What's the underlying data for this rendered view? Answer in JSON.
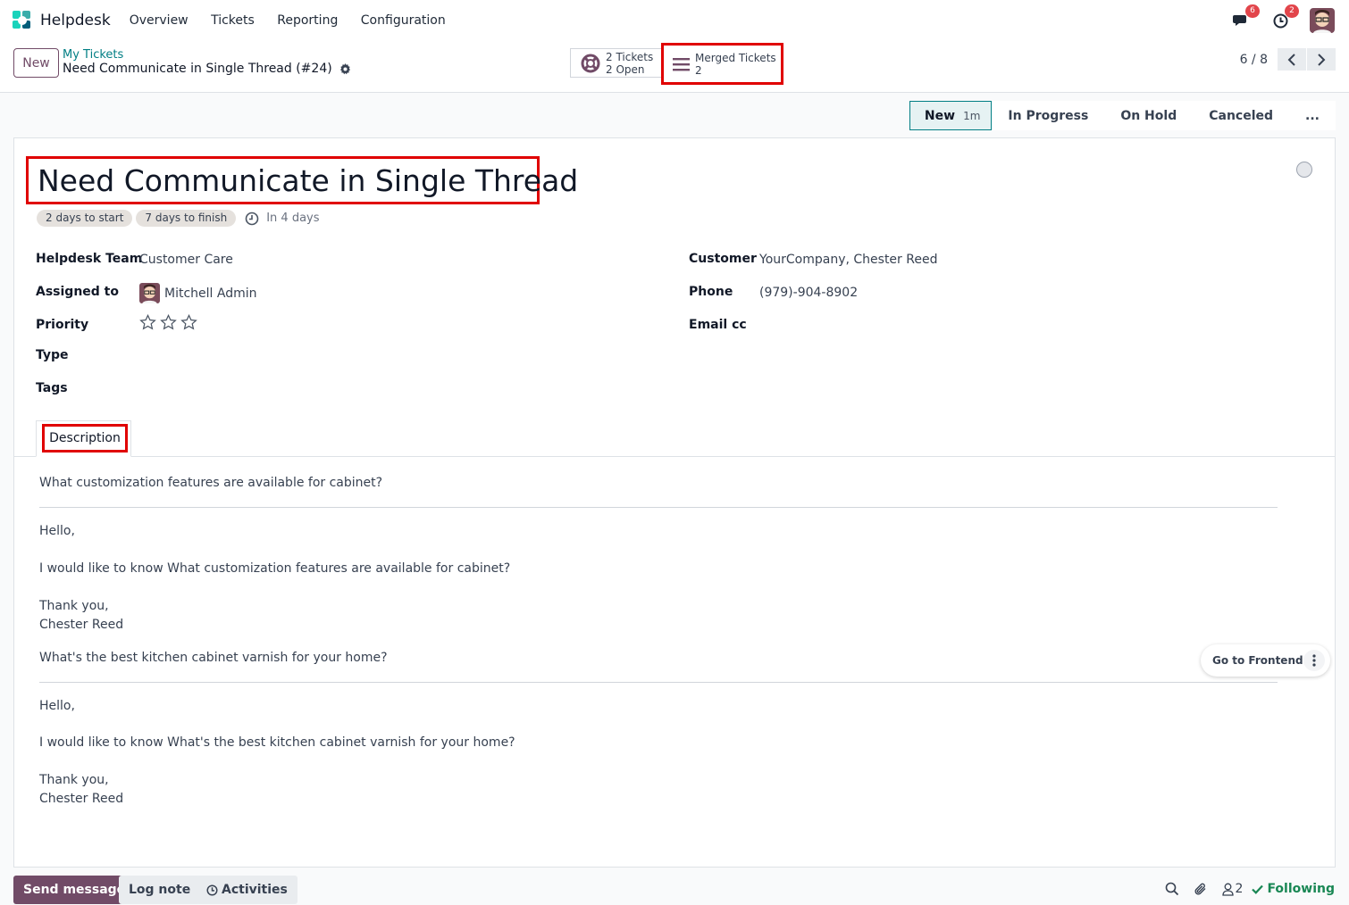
{
  "app": {
    "name": "Helpdesk",
    "nav": [
      "Overview",
      "Tickets",
      "Reporting",
      "Configuration"
    ]
  },
  "systray": {
    "messages_count": "6",
    "activities_count": "2"
  },
  "breadcrumb": {
    "new_label": "New",
    "parent": "My Tickets",
    "current": "Need Communicate in Single Thread (#24)"
  },
  "smart_buttons": {
    "tickets": {
      "line1": "2 Tickets",
      "line2": "2 Open"
    },
    "merged": {
      "line1": "Merged Tickets",
      "line2": "2"
    }
  },
  "pager": {
    "value": "6 / 8"
  },
  "stages": {
    "current": "New",
    "current_duration": "1m",
    "others": [
      "In Progress",
      "On Hold",
      "Canceled"
    ],
    "more": "..."
  },
  "ticket": {
    "title": "Need Communicate in Single Thread",
    "sla_tags": [
      "2 days to start",
      "7 days to finish"
    ],
    "deadline": "In 4 days"
  },
  "fields_left": {
    "team_label": "Helpdesk Team",
    "team_value": "Customer Care",
    "assigned_label": "Assigned to",
    "assigned_value": "Mitchell Admin",
    "priority_label": "Priority",
    "priority_stars": 0,
    "priority_max": 3,
    "type_label": "Type",
    "tags_label": "Tags"
  },
  "fields_right": {
    "customer_label": "Customer",
    "customer_value": "YourCompany, Chester Reed",
    "phone_label": "Phone",
    "phone_value": "(979)-904-8902",
    "emailcc_label": "Email cc"
  },
  "tabs": {
    "description": "Description"
  },
  "description": {
    "block1": {
      "question": "What customization features are available for cabinet?",
      "greeting": "Hello,",
      "body": "I would like to know What customization features are available for cabinet?",
      "thanks": "Thank you,",
      "signature": "Chester Reed"
    },
    "block2": {
      "question": "What's the best kitchen cabinet varnish for your home?",
      "greeting": "Hello,",
      "body": "I would like to know What's the best kitchen cabinet varnish for your home?",
      "thanks": "Thank you,",
      "signature": "Chester Reed"
    }
  },
  "floating": {
    "go_to_frontend": "Go to Frontend"
  },
  "chatter": {
    "send": "Send message",
    "log": "Log note",
    "activities": "Activities",
    "followers_count": "2",
    "following": "Following"
  },
  "colors": {
    "primary": "#714b67",
    "teal": "#017e84",
    "highlight": "#e00000",
    "badge": "#e2454b",
    "following": "#198754"
  }
}
